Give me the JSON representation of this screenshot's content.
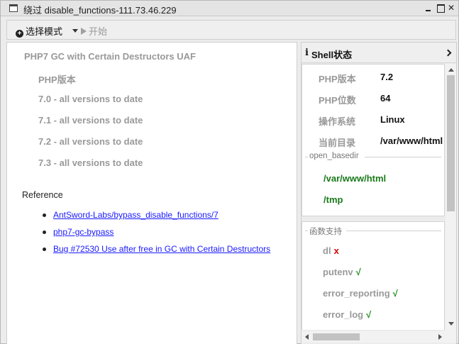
{
  "window": {
    "title": "绕过 disable_functions-111.73.46.229"
  },
  "toolbar": {
    "select_mode_label": "选择模式",
    "start_label": "开始"
  },
  "left": {
    "exploit_title": "PHP7 GC with Certain Destructors UAF",
    "php_version_label": "PHP版本",
    "versions": [
      "7.0 - all versions to date",
      "7.1 - all versions to date",
      "7.2 - all versions to date",
      "7.3 - all versions to date"
    ],
    "reference_title": "Reference",
    "references": [
      "AntSword-Labs/bypass_disable_functions/7",
      "php7-gc-bypass",
      "Bug #72530 Use after free in GC with Certain Destructors"
    ]
  },
  "right": {
    "header_title": "Shell状态",
    "info": [
      {
        "key": "PHP版本",
        "value": "7.2"
      },
      {
        "key": "PHP位数",
        "value": "64"
      },
      {
        "key": "操作系统",
        "value": "Linux"
      },
      {
        "key": "当前目录",
        "value": "/var/www/html"
      }
    ],
    "open_basedir_label": "open_basedir",
    "open_basedir_paths": [
      "/var/www/html",
      "/tmp"
    ],
    "functions_label": "函数支持",
    "functions": [
      {
        "name": "dl",
        "mark": "x",
        "supported": false
      },
      {
        "name": "putenv",
        "mark": "√",
        "supported": true
      },
      {
        "name": "error_reporting",
        "mark": "√",
        "supported": true
      },
      {
        "name": "error_log",
        "mark": "√",
        "supported": true
      }
    ]
  }
}
